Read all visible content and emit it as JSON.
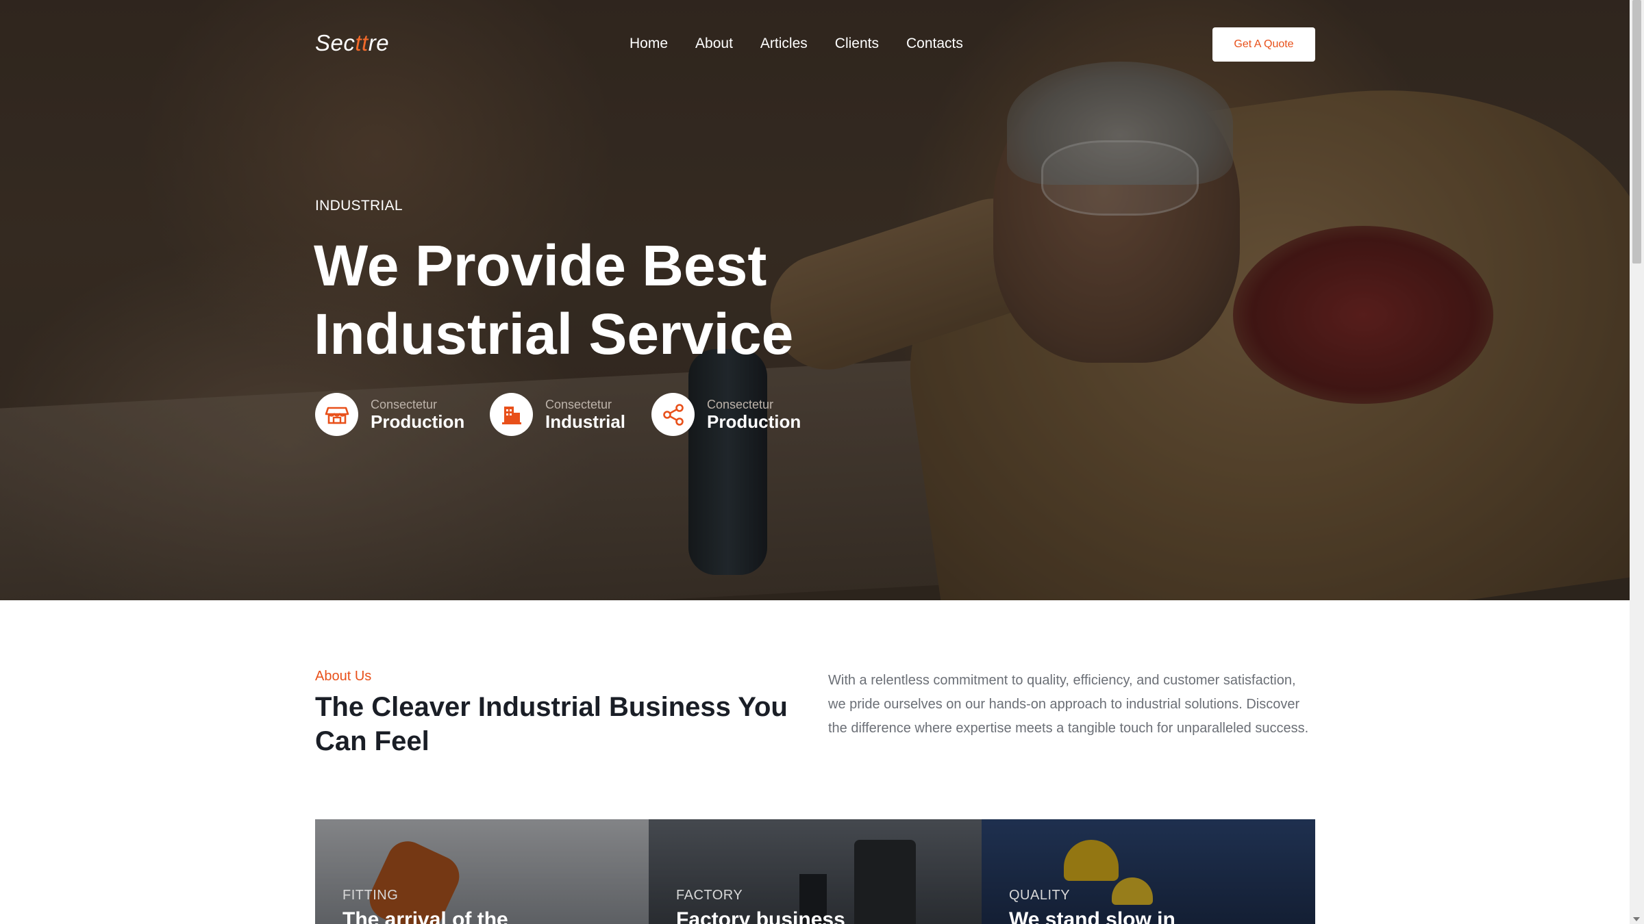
{
  "brand": {
    "logo_prefix": "Sec",
    "logo_accent": "tt",
    "logo_suffix": "re",
    "accent_color": "#e8501a"
  },
  "nav": {
    "items": [
      "Home",
      "About",
      "Articles",
      "Clients",
      "Contacts"
    ],
    "cta_label": "Get A Quote"
  },
  "hero": {
    "kicker": "INDUSTRIAL",
    "title_line1": "We Provide Best",
    "title_line2": "Industrial Service",
    "features": [
      {
        "sub": "Consectetur",
        "main": "Production",
        "icon": "store-icon"
      },
      {
        "sub": "Consectetur",
        "main": "Industrial",
        "icon": "building-icon"
      },
      {
        "sub": "Consectetur",
        "main": "Production",
        "icon": "share-nodes-icon"
      }
    ]
  },
  "about": {
    "kicker": "About Us",
    "title": "The Cleaver Industrial Business You Can Feel",
    "text": "With a relentless commitment to quality, efficiency, and customer satisfaction, we pride ourselves on our hands-on approach to industrial solutions. Discover the difference where expertise meets a tangible touch for unparalleled success."
  },
  "cards": [
    {
      "category": "FITTING",
      "title": "The arrival of the"
    },
    {
      "category": "FACTORY",
      "title": "Factory business"
    },
    {
      "category": "QUALITY",
      "title": "We stand slow in"
    }
  ]
}
